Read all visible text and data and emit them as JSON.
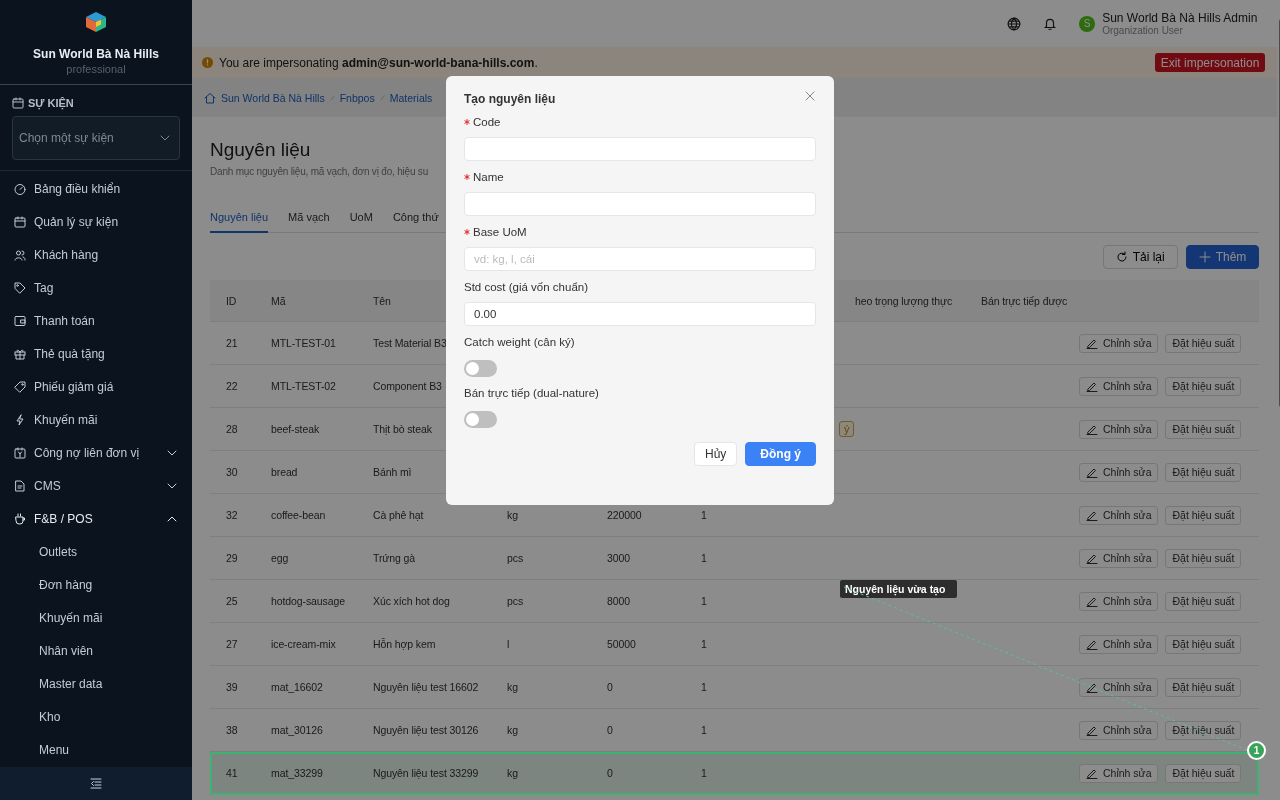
{
  "sidebar": {
    "brand": "Sun World Bà Nà Hills",
    "plan": "professional",
    "event_section": {
      "label": "SỰ KIỆN",
      "select_placeholder": "Chọn một sự kiện"
    },
    "items": [
      {
        "kind": "link",
        "label": "Bảng điều khiển"
      },
      {
        "kind": "link",
        "label": "Quản lý sự kiện"
      },
      {
        "kind": "link",
        "label": "Khách hàng"
      },
      {
        "kind": "link",
        "label": "Tag"
      },
      {
        "kind": "link",
        "label": "Thanh toán"
      },
      {
        "kind": "link",
        "label": "Thẻ quà tặng"
      },
      {
        "kind": "link",
        "label": "Phiếu giảm giá"
      },
      {
        "kind": "link",
        "label": "Khuyến mãi"
      },
      {
        "kind": "group",
        "label": "Công nợ liên đơn vị",
        "expanded": false
      },
      {
        "kind": "group",
        "label": "CMS",
        "expanded": false
      },
      {
        "kind": "group",
        "label": "F&B / POS",
        "expanded": true,
        "children": [
          {
            "label": "Outlets"
          },
          {
            "label": "Đơn hàng"
          },
          {
            "label": "Khuyến mãi"
          },
          {
            "label": "Nhân viên"
          },
          {
            "label": "Master data"
          },
          {
            "label": "Kho"
          },
          {
            "label": "Menu"
          }
        ]
      }
    ]
  },
  "header": {
    "avatar_letter": "S",
    "user_name": "Sun World Bà Nà Hills Admin",
    "user_role": "Organization User"
  },
  "banner": {
    "text": "You are impersonating **admin@sun-world-bana-hills.com**.",
    "button": "Exit impersonation"
  },
  "breadcrumb": [
    "Sun World Bà Nà Hills",
    "Fnbpos",
    "Materials"
  ],
  "page": {
    "title": "Nguyên liệu",
    "subtitle": "Danh mục nguyên liệu, mã vạch, đơn vị đo, hiệu su",
    "tabs": [
      {
        "label": "Nguyên liệu",
        "selected": true
      },
      {
        "label": "Mã vạch",
        "selected": false
      },
      {
        "label": "UoM",
        "selected": false
      },
      {
        "label": "Công thứ",
        "selected": false
      }
    ],
    "reload_button": "Tải lại",
    "add_button": "Thêm"
  },
  "table": {
    "columns": [
      "ID",
      "Mã",
      "Tên"
    ],
    "columns_right": [
      "heo trọng lượng thực",
      "Bán trực tiếp được"
    ],
    "rows": [
      {
        "id": "21",
        "code": "MTL-TEST-01",
        "name": "Test Material B3",
        "actions": [
          "Chỉnh sửa",
          "Đặt hiệu suất"
        ],
        "highlighted": false
      },
      {
        "id": "22",
        "code": "MTL-TEST-02",
        "name": "Component B3",
        "actions": [
          "Chỉnh sửa",
          "Đặt hiệu suất"
        ],
        "highlighted": false
      },
      {
        "id": "28",
        "code": "beef-steak",
        "name": "Thịt bò steak",
        "tag": "ý",
        "actions": [
          "Chỉnh sửa",
          "Đặt hiệu suất"
        ],
        "highlighted": false
      },
      {
        "id": "30",
        "code": "bread",
        "name": "Bánh mì",
        "actions": [
          "Chỉnh sửa",
          "Đặt hiệu suất"
        ],
        "highlighted": false
      },
      {
        "id": "32",
        "code": "coffee-bean",
        "name": "Cà phê hạt",
        "uom": "kg",
        "cost": "220000",
        "column_6": "1",
        "actions": [
          "Chỉnh sửa",
          "Đặt hiệu suất"
        ],
        "highlighted": false
      },
      {
        "id": "29",
        "code": "egg",
        "name": "Trứng gà",
        "uom": "pcs",
        "cost": "3000",
        "column_6": "1",
        "actions": [
          "Chỉnh sửa",
          "Đặt hiệu suất"
        ],
        "highlighted": false
      },
      {
        "id": "25",
        "code": "hotdog-sausage",
        "name": "Xúc xích hot dog",
        "uom": "pcs",
        "cost": "8000",
        "column_6": "1",
        "actions": [
          "Chỉnh sửa",
          "Đặt hiệu suất"
        ],
        "highlighted": false
      },
      {
        "id": "27",
        "code": "ice-cream-mix",
        "name": "Hỗn hợp kem",
        "uom": "l",
        "cost": "50000",
        "column_6": "1",
        "actions": [
          "Chỉnh sửa",
          "Đặt hiệu suất"
        ],
        "highlighted": false
      },
      {
        "id": "39",
        "code": "mat_16602",
        "name": "Nguyên liệu test 16602",
        "uom": "kg",
        "cost": "0",
        "column_6": "1",
        "actions": [
          "Chỉnh sửa",
          "Đặt hiệu suất"
        ],
        "highlighted": false
      },
      {
        "id": "38",
        "code": "mat_30126",
        "name": "Nguyên liệu test 30126",
        "uom": "kg",
        "cost": "0",
        "column_6": "1",
        "actions": [
          "Chỉnh sửa",
          "Đặt hiệu suất"
        ],
        "highlighted": false
      },
      {
        "id": "41",
        "code": "mat_33299",
        "name": "Nguyên liệu test 33299",
        "uom": "kg",
        "cost": "0",
        "column_6": "1",
        "actions": [
          "Chỉnh sửa",
          "Đặt hiệu suất"
        ],
        "highlighted": true
      }
    ]
  },
  "annotation": {
    "label": "Nguyên liệu vừa tạo",
    "badge": "1"
  },
  "modal": {
    "title": "Tạo nguyên liệu",
    "fields": [
      {
        "kind": "text",
        "label": "Code",
        "required": true
      },
      {
        "kind": "text",
        "label": "Name",
        "required": true
      },
      {
        "kind": "text",
        "label": "Base UoM",
        "required": true,
        "placeholder": "vd: kg, l, cái"
      },
      {
        "kind": "text",
        "label": "Std cost (giá vốn chuẩn)",
        "required": false,
        "value": "0.00"
      },
      {
        "kind": "switch",
        "label": "Catch weight (cân ký)",
        "on": false
      },
      {
        "kind": "switch",
        "label": "Bán trực tiếp (dual-nature)",
        "on": false
      }
    ],
    "cancel_button": "Hủy",
    "ok_button": "Đồng ý"
  }
}
